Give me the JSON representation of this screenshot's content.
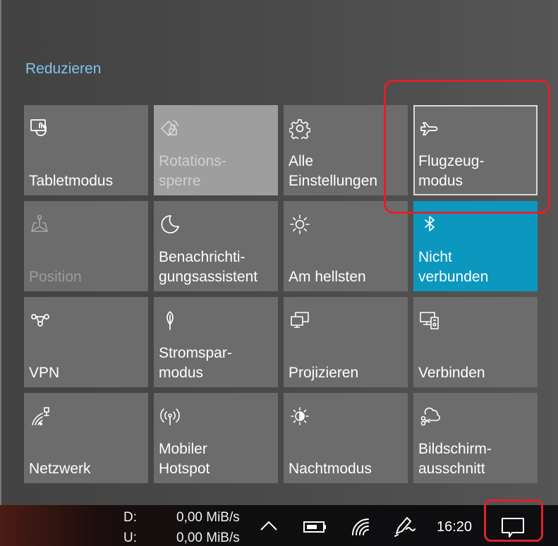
{
  "header": {
    "collapse_label": "Reduzieren"
  },
  "tiles": [
    {
      "label": "Tabletmodus",
      "icon": "tablet-mode-icon"
    },
    {
      "label": "Rotations-\nsperre",
      "icon": "rotation-lock-icon"
    },
    {
      "label": "Alle\nEinstellungen",
      "icon": "settings-gear-icon"
    },
    {
      "label": "Flugzeug-\nmodus",
      "icon": "airplane-icon"
    },
    {
      "label": "Position",
      "icon": "location-icon"
    },
    {
      "label": "Benachrichti-\ngungsassistent",
      "icon": "moon-icon"
    },
    {
      "label": "Am hellsten",
      "icon": "brightness-icon"
    },
    {
      "label": "Nicht\nverbunden",
      "icon": "bluetooth-icon"
    },
    {
      "label": "VPN",
      "icon": "vpn-icon"
    },
    {
      "label": "Stromspar-\nmodus",
      "icon": "battery-saver-leaf-icon"
    },
    {
      "label": "Projizieren",
      "icon": "project-screen-icon"
    },
    {
      "label": "Verbinden",
      "icon": "connect-devices-icon"
    },
    {
      "label": "Netzwerk",
      "icon": "network-icon"
    },
    {
      "label": "Mobiler\nHotspot",
      "icon": "mobile-hotspot-icon"
    },
    {
      "label": "Nachtmodus",
      "icon": "night-light-icon"
    },
    {
      "label": "Bildschirm-\nausschnitt",
      "icon": "screen-snip-icon"
    }
  ],
  "taskbar": {
    "download_label": "D:",
    "download_rate": "0,00 MiB/s",
    "upload_label": "U:",
    "upload_rate": "0,00 MiB/s",
    "time": "16:20"
  },
  "colors": {
    "accent_link": "#7ec3f0",
    "tile": "#6c6c6c",
    "tile_active": "#0c97be",
    "highlight": "#e0202b"
  }
}
